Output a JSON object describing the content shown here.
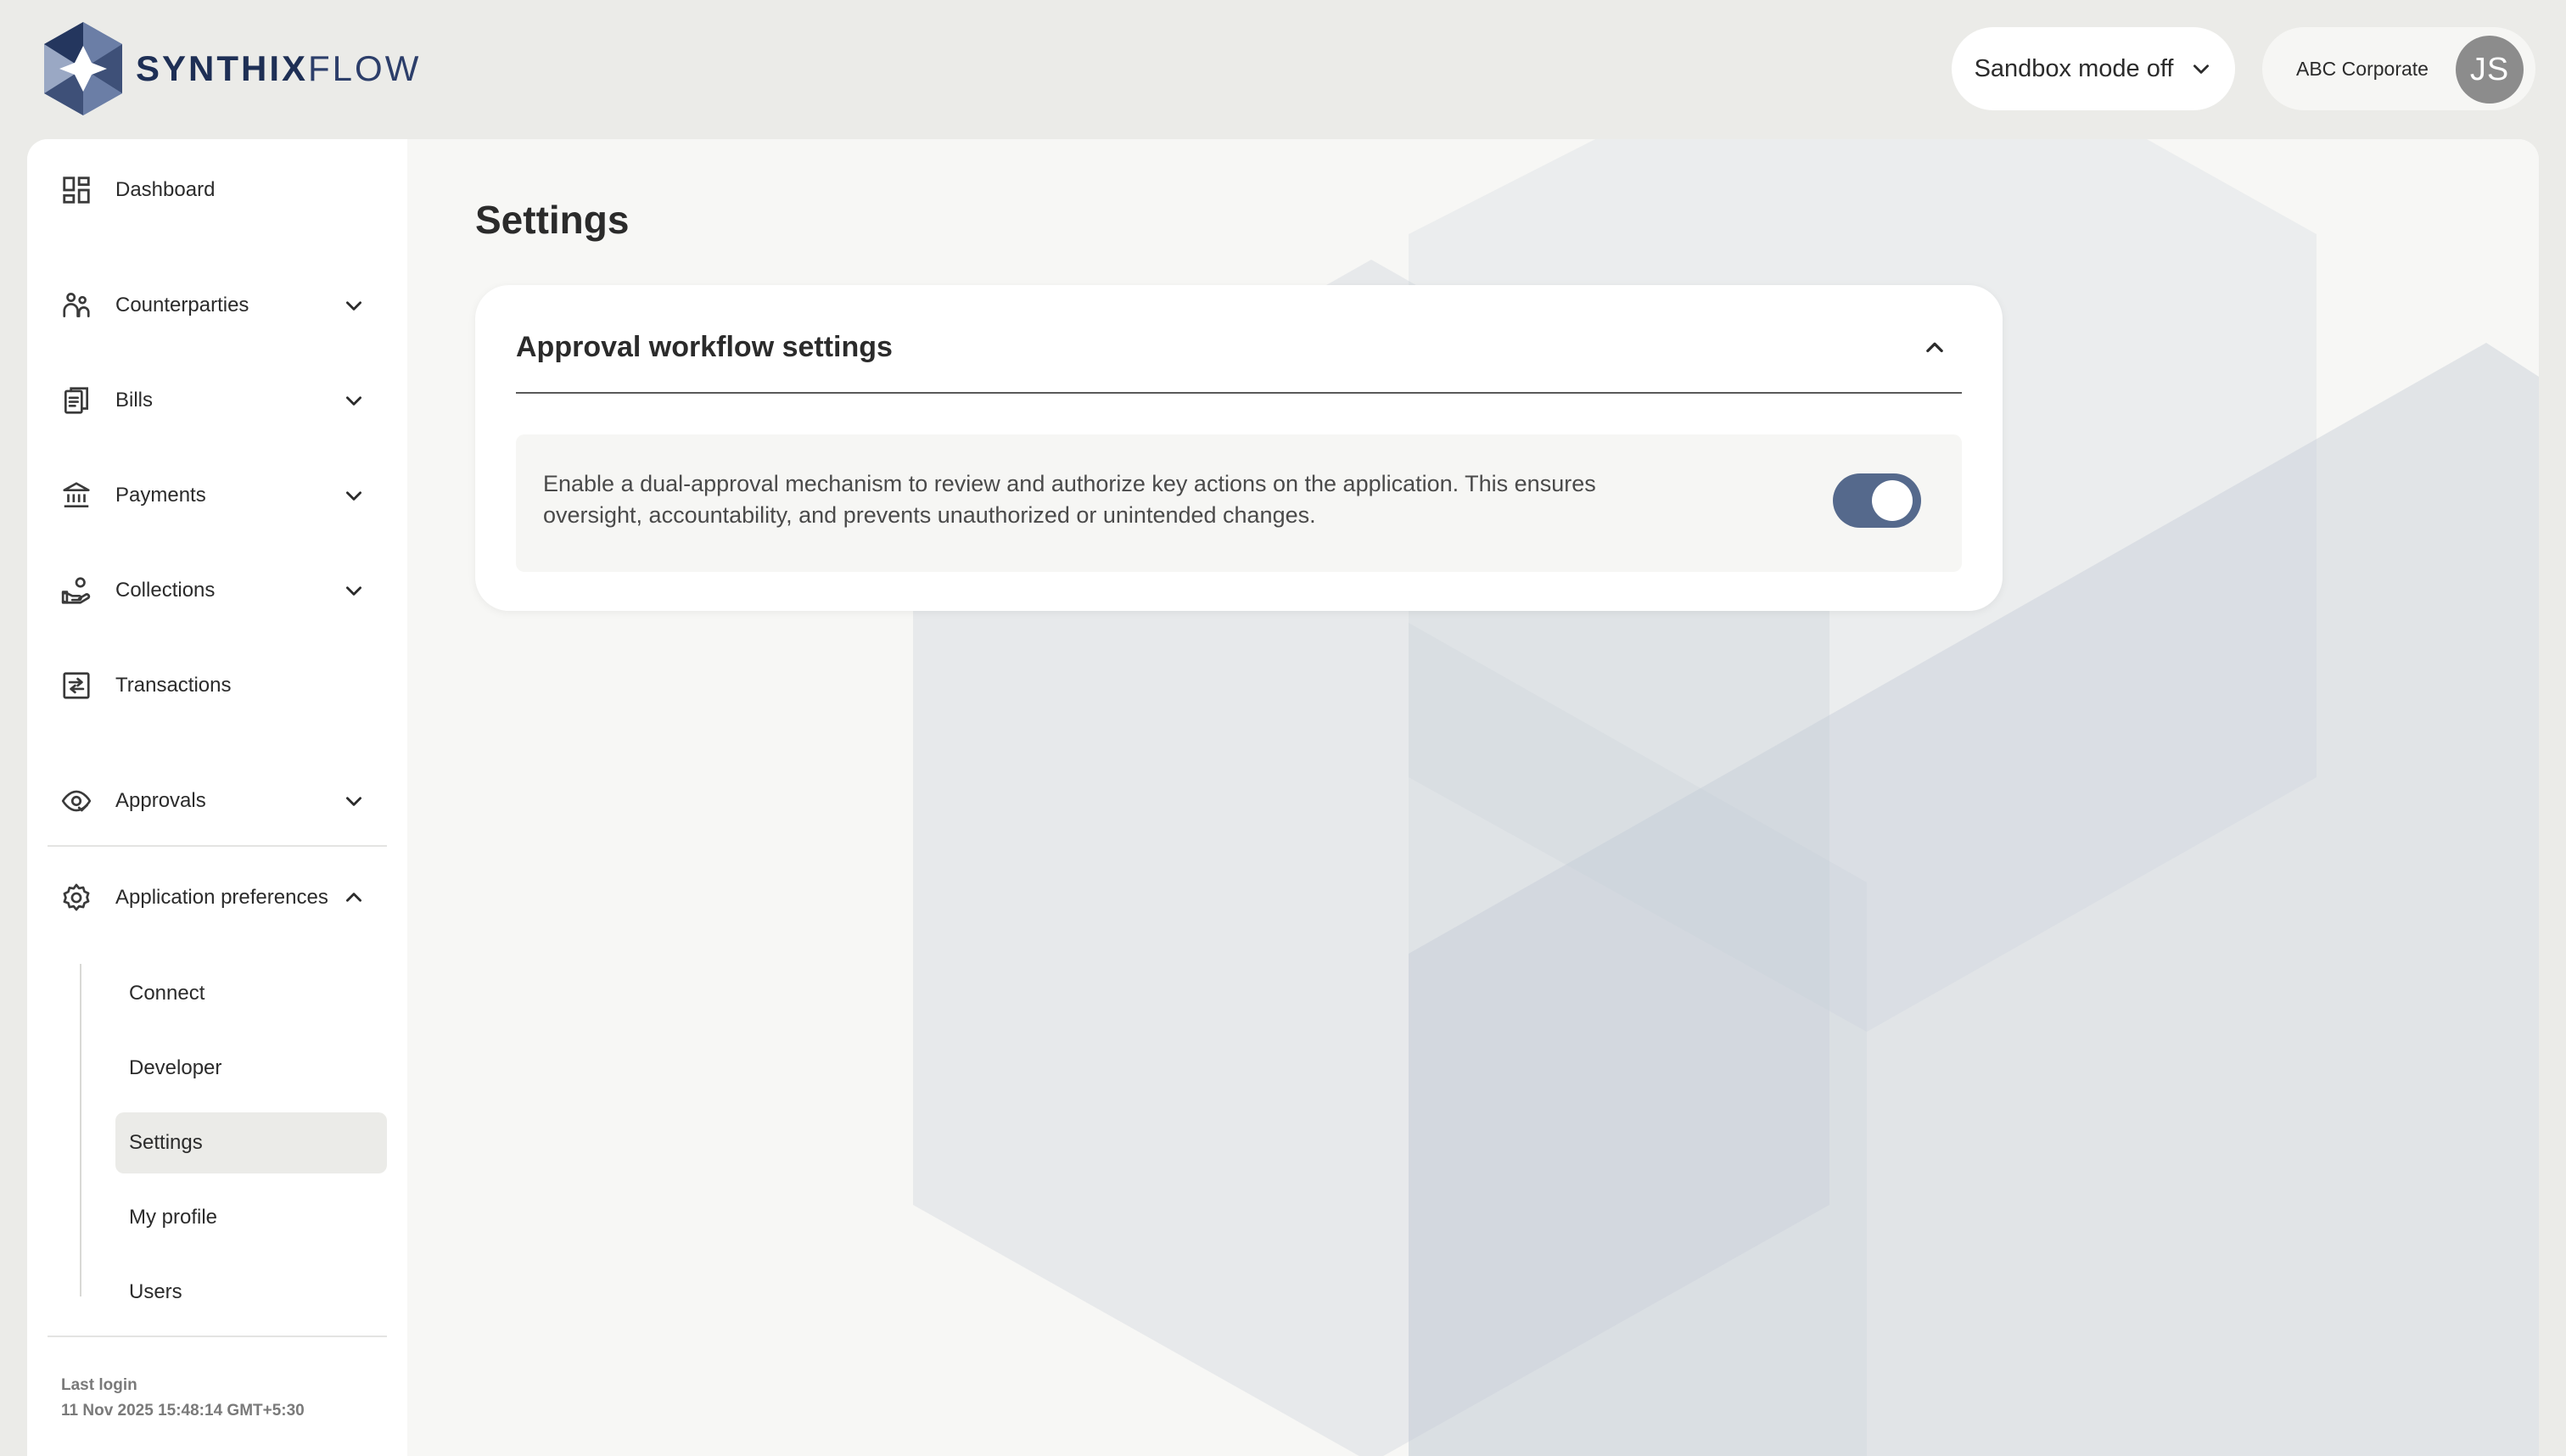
{
  "brand": {
    "name_strong": "SYNTHIX",
    "name_light": "FLOW",
    "mark_colors": [
      "#6b7ea6",
      "#3e5078",
      "#9aa8c4",
      "#24365e"
    ]
  },
  "header": {
    "sandbox_label": "Sandbox mode off",
    "account_name": "ABC Corporate",
    "avatar_initials": "JS"
  },
  "sidebar": {
    "items": [
      {
        "label": "Dashboard",
        "icon": "dashboard-grid-icon",
        "chevron": false
      },
      {
        "label": "Counterparties",
        "icon": "people-icon",
        "chevron": true
      },
      {
        "label": "Bills",
        "icon": "document-icon",
        "chevron": true
      },
      {
        "label": "Payments",
        "icon": "bank-icon",
        "chevron": true
      },
      {
        "label": "Collections",
        "icon": "hand-coins-icon",
        "chevron": true
      },
      {
        "label": "Transactions",
        "icon": "swap-arrows-icon",
        "chevron": false
      },
      {
        "label": "Approvals",
        "icon": "eye-icon",
        "chevron": true
      },
      {
        "label": "Application preferences",
        "icon": "gear-icon",
        "chevron": "up"
      }
    ],
    "sub_items": [
      "Connect",
      "Developer",
      "Settings",
      "My profile",
      "Users"
    ],
    "active_sub_item": "Settings",
    "last_login_label": "Last login",
    "last_login_value": "11 Nov 2025 15:48:14 GMT+5:30"
  },
  "main": {
    "page_title": "Settings",
    "card": {
      "title": "Approval workflow settings",
      "expanded": true,
      "description": "Enable a dual-approval mechanism to review and authorize key actions on the application. This ensures oversight, accountability, and prevents unauthorized or unintended changes.",
      "toggle_on": true
    }
  },
  "colors": {
    "toggle_on": "#55698c",
    "active_nav_bg": "#ebebe8",
    "page_bg": "#ebebe8"
  }
}
